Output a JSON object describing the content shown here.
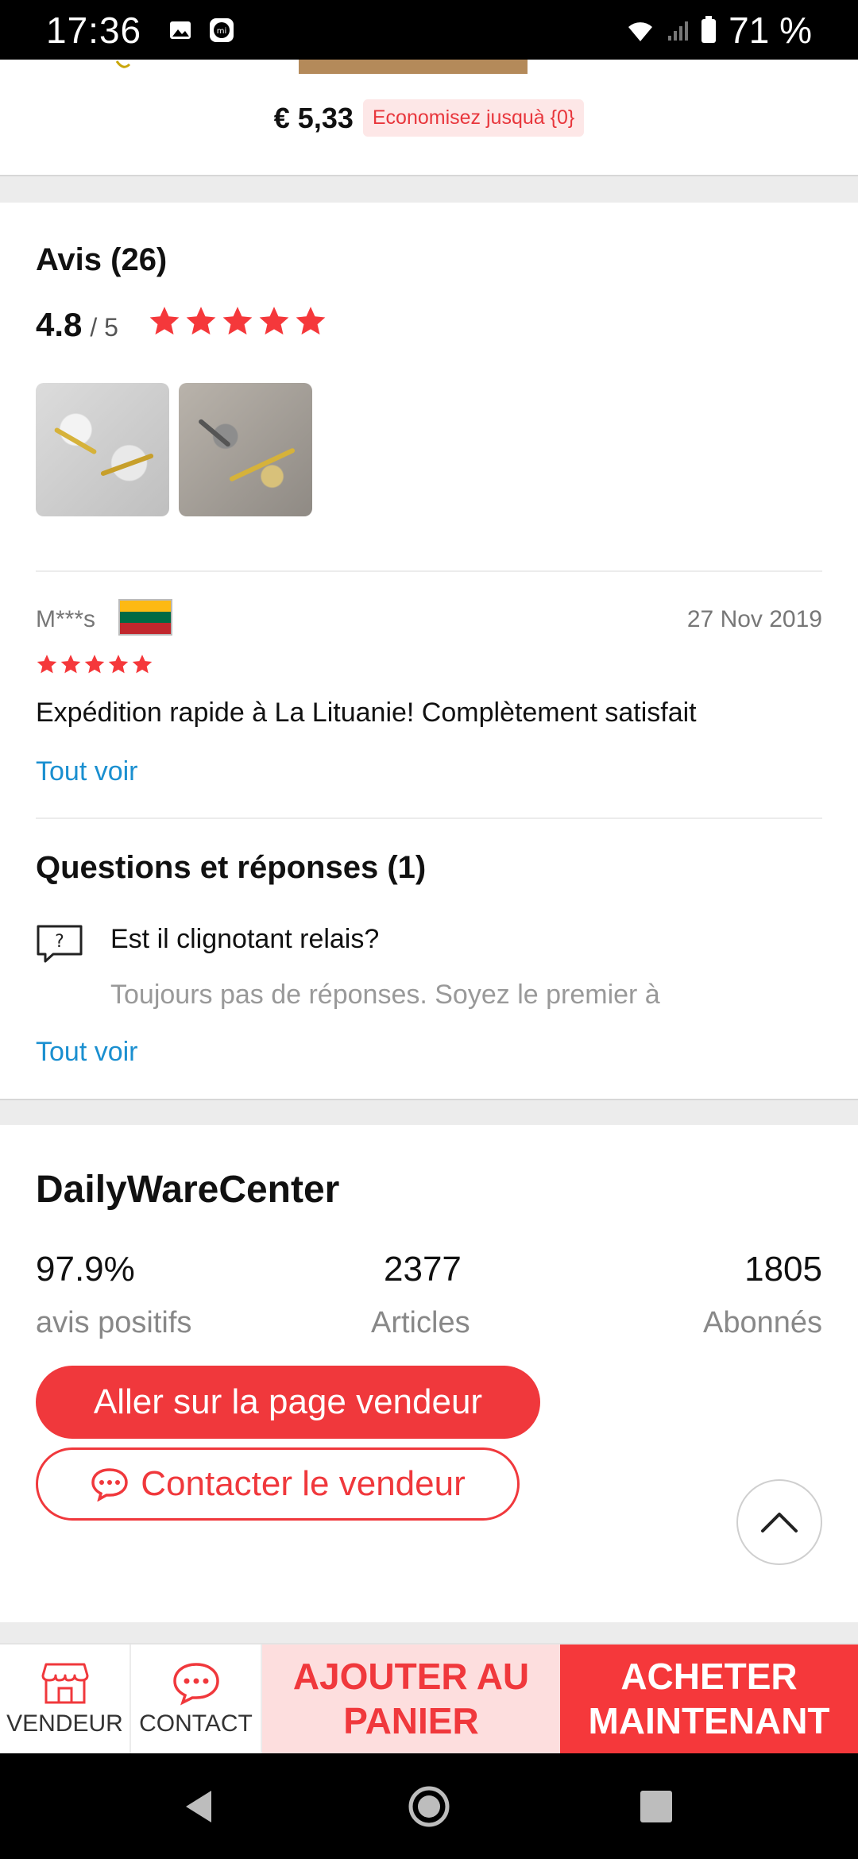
{
  "status_bar": {
    "time": "17:36",
    "battery": "71 %"
  },
  "product": {
    "price": "€ 5,33",
    "save_label": "Economisez jusquà {0}"
  },
  "reviews": {
    "title": "Avis (26)",
    "rating": "4.8",
    "rating_max": "/ 5",
    "stars": 5,
    "review": {
      "author": "M***s",
      "country": "Lituanie",
      "date": "27 Nov 2019",
      "stars": 5,
      "text": "Expédition rapide à La Lituanie! Complètement satisfait"
    },
    "see_all": "Tout voir"
  },
  "qa": {
    "title": "Questions et réponses (1)",
    "question": "Est il clignotant relais?",
    "answer": "Toujours pas de réponses. Soyez le premier à",
    "see_all": "Tout voir"
  },
  "seller": {
    "name": "DailyWareCenter",
    "stats": [
      {
        "value": "97.9%",
        "label": "avis positifs"
      },
      {
        "value": "2377",
        "label": "Articles"
      },
      {
        "value": "1805",
        "label": "Abonnés"
      }
    ],
    "store_button": "Aller sur la page vendeur",
    "contact_button": "Contacter le vendeur"
  },
  "action_bar": {
    "store_label": "VENDEUR",
    "contact_label": "CONTACT",
    "cart_line1": "AJOUTER AU",
    "cart_line2": "PANIER",
    "buy_line1": "ACHETER",
    "buy_line2": "MAINTENANT"
  },
  "colors": {
    "accent": "#f0383c",
    "link": "#1a8fd0",
    "star": "#f5383b"
  }
}
